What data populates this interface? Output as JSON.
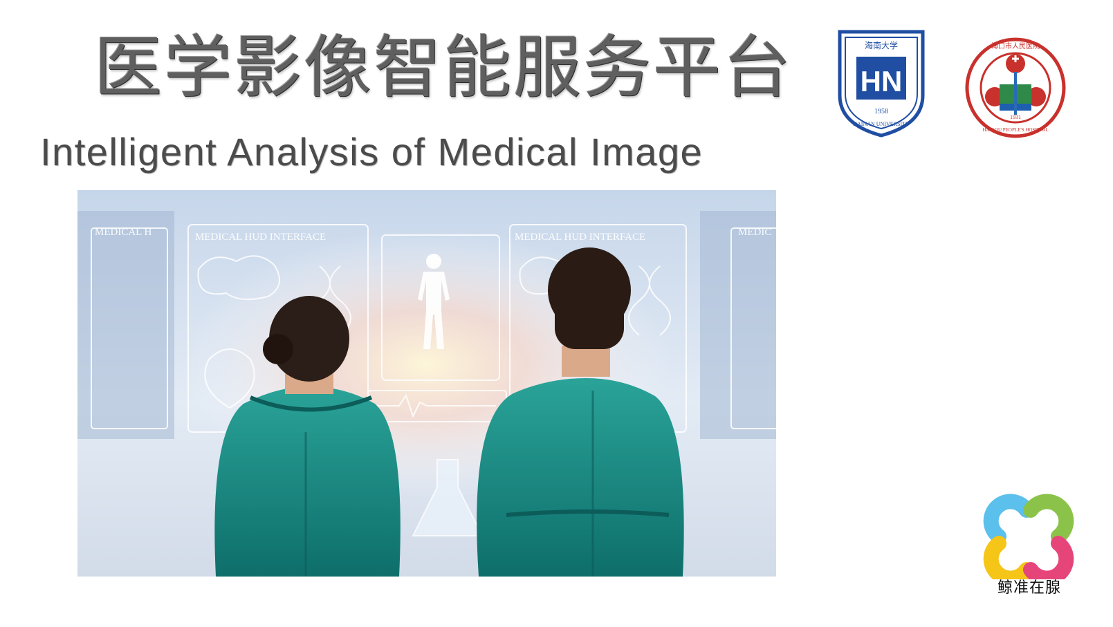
{
  "slide": {
    "title_cn": "医学影像智能服务平台",
    "title_en": "Intelligent Analysis of Medical Image"
  },
  "hero_image": {
    "panel_title_left": "MEDICAL HUD INTERFACE",
    "panel_title_right": "MEDICAL HUD INTERFACE",
    "panel_title_edge_right": "MEDIC",
    "panel_title_edge_left": "MEDICAL H"
  },
  "logos": {
    "hainan_university": {
      "cn": "海南大学",
      "monogram": "HN",
      "en": "HAINAN UNIVERSITY",
      "year": "1958"
    },
    "haikou_hospital": {
      "cn": "海口市人民医院",
      "en": "HAIKOU PEOPLE'S HOSPITAL",
      "year": "1931"
    }
  },
  "brand": {
    "name": "鲸准在腺",
    "colors": [
      "#5bc0eb",
      "#8bc34a",
      "#f5c518",
      "#e6457a"
    ]
  }
}
